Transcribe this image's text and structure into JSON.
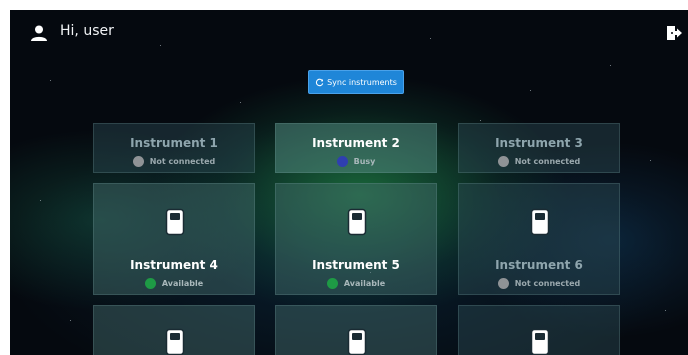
{
  "header": {
    "greeting": "Hi, user"
  },
  "actions": {
    "sync_label": "Sync instruments"
  },
  "colors": {
    "accent": "#1f86d8",
    "status_not_connected": "#8f9396",
    "status_busy": "#2f3fb0",
    "status_available": "#1e9a45"
  },
  "instruments": [
    {
      "name": "Instrument 1",
      "status": "Not connected"
    },
    {
      "name": "Instrument 2",
      "status": "Busy"
    },
    {
      "name": "Instrument 3",
      "status": "Not connected"
    },
    {
      "name": "Instrument 4",
      "status": "Available"
    },
    {
      "name": "Instrument 5",
      "status": "Available"
    },
    {
      "name": "Instrument 6",
      "status": "Not connected"
    }
  ],
  "icons": {
    "user": "user-icon",
    "logout": "logout-icon",
    "sync": "sync-icon",
    "device": "device-icon"
  }
}
